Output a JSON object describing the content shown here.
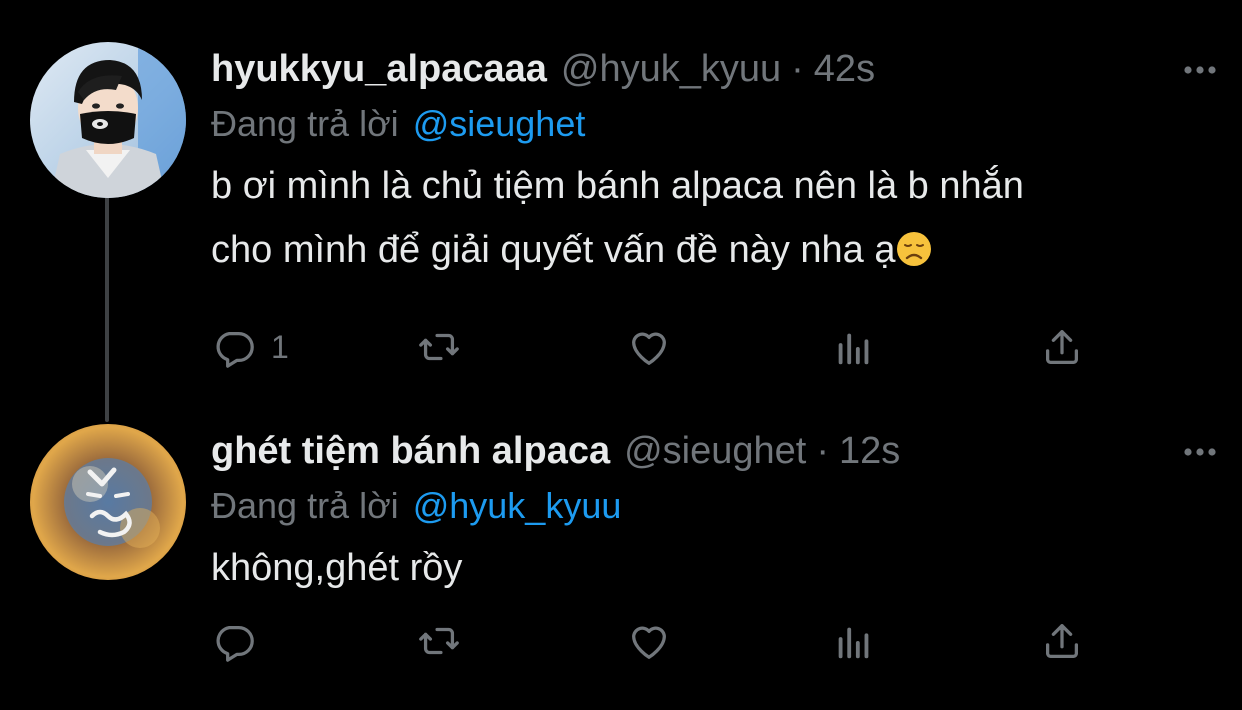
{
  "tweets": [
    {
      "display_name": "hyukkyu_alpacaaa",
      "handle": "@hyuk_kyuu",
      "separator": "·",
      "time": "42s",
      "reply_prefix": "Đang trả lời",
      "reply_to": "@sieughet",
      "text": "b ơi mình là chủ tiệm bánh alpaca nên là b nhắn\ncho mình để giải quyết vấn đề này nha ạ",
      "emoji": "disappointed-face-emoji",
      "reply_count": "1"
    },
    {
      "display_name": "ghét tiệm bánh alpaca",
      "handle": "@sieughet",
      "separator": "·",
      "time": "12s",
      "reply_prefix": "Đang trả lời",
      "reply_to": "@hyuk_kyuu",
      "text": "không,ghét rồy",
      "reply_count": ""
    }
  ],
  "icons": {
    "reply": "reply-icon",
    "retweet": "retweet-icon",
    "like": "heart-icon",
    "views": "views-icon",
    "share": "share-icon",
    "more": "more-icon"
  },
  "colors": {
    "background": "#000000",
    "text_primary": "#e7e9ea",
    "text_secondary": "#71767b",
    "accent": "#1d9bf0",
    "thread_line": "#3e4144"
  }
}
